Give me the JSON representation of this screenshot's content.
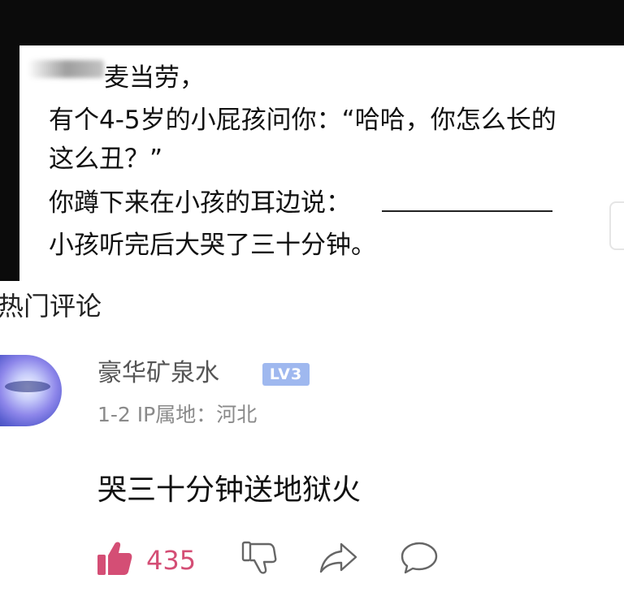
{
  "post": {
    "lines": [
      "麦当劳，",
      "有个4-5岁的小屁孩问你：“哈哈，你怎么长的",
      "这么丑？”",
      "你蹲下来在小孩的耳边说：",
      "小孩听完后大哭了三十分钟。"
    ]
  },
  "section": {
    "title": "热门评论"
  },
  "comment": {
    "user_name": "豪华矿泉水",
    "level_badge": "LV3",
    "meta": "1-2 IP属地：河北",
    "text": "哭三十分钟送地狱火",
    "like_count": "435"
  },
  "icons": {
    "like": "thumbs-up-icon",
    "dislike": "thumbs-down-icon",
    "share": "share-icon",
    "reply": "comment-icon"
  },
  "colors": {
    "accent_pink": "#d44e75",
    "badge_blue": "#9fb8ef",
    "meta_gray": "#8a8a8a"
  }
}
